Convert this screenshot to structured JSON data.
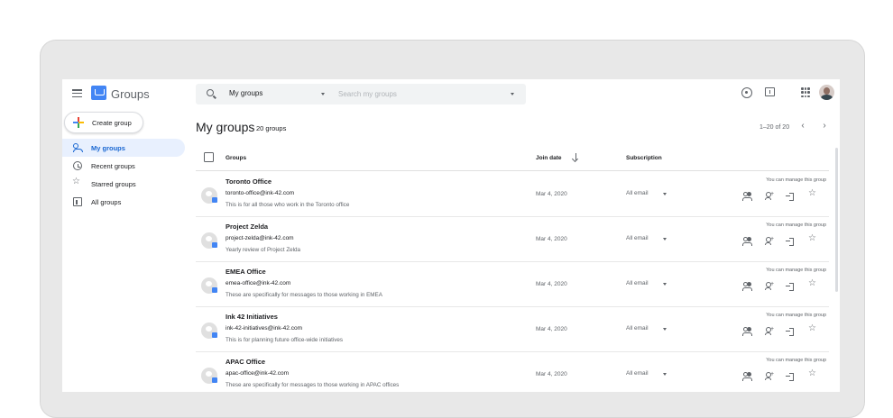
{
  "header": {
    "app_title": "Groups",
    "search_scope": "My groups",
    "search_placeholder": "Search my groups"
  },
  "sidebar": {
    "create_label": "Create group",
    "items": [
      {
        "label": "My groups",
        "icon": "people-icon",
        "active": true
      },
      {
        "label": "Recent groups",
        "icon": "clock-icon",
        "active": false
      },
      {
        "label": "Starred groups",
        "icon": "star-icon",
        "active": false
      },
      {
        "label": "All groups",
        "icon": "building-icon",
        "active": false
      }
    ]
  },
  "main": {
    "title": "My groups",
    "count": "20 groups",
    "pager": "1–20 of 20",
    "columns": {
      "groups": "Groups",
      "join_date": "Join date",
      "subscription": "Subscription"
    },
    "rows": [
      {
        "name": "Toronto Office",
        "email": "toronto-office@ink-42.com",
        "description": "This is for all those who work in the Toronto office",
        "join_date": "Mar 4, 2020",
        "subscription": "All email",
        "manage": "You can manage this group"
      },
      {
        "name": "Project Zelda",
        "email": "project-zelda@ink-42.com",
        "description": "Yearly review of Project Zelda",
        "join_date": "Mar 4, 2020",
        "subscription": "All email",
        "manage": "You can manage this group"
      },
      {
        "name": "EMEA Office",
        "email": "emea-office@ink-42.com",
        "description": "These are specifically for messages to those working in EMEA",
        "join_date": "Mar 4, 2020",
        "subscription": "All email",
        "manage": "You can manage this group"
      },
      {
        "name": "Ink 42 Initiatives",
        "email": "ink-42-initiatives@ink-42.com",
        "description": "This is for planning future office-wide initiatives",
        "join_date": "Mar 4, 2020",
        "subscription": "All email",
        "manage": "You can manage this group"
      },
      {
        "name": "APAC Office",
        "email": "apac-office@ink-42.com",
        "description": "These are specifically for messages to those working in APAC offices",
        "join_date": "Mar 4, 2020",
        "subscription": "All email",
        "manage": "You can manage this group"
      }
    ]
  },
  "colors": {
    "accent": "#1967d2",
    "active_nav_bg": "#e8f0fe",
    "logo_blue": "#4285f4"
  }
}
